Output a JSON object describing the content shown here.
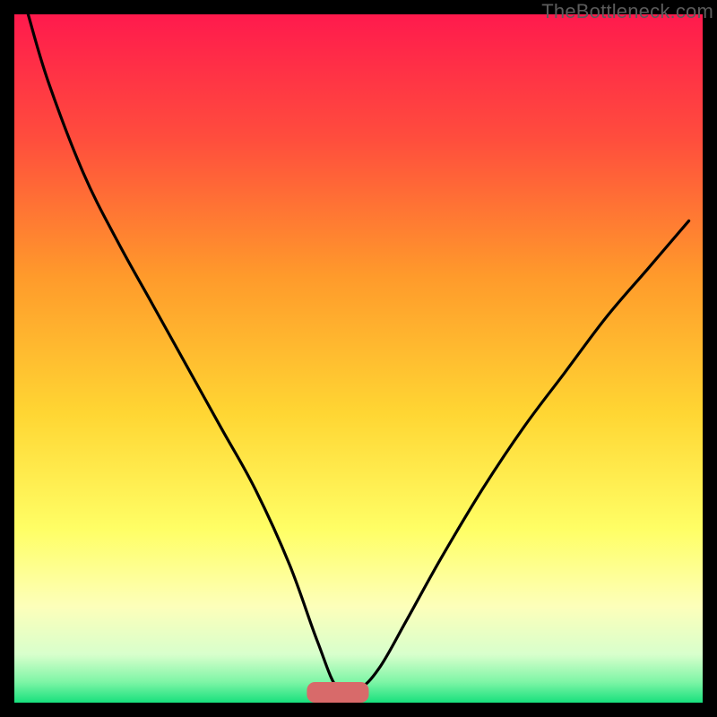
{
  "watermark": "TheBottleneck.com",
  "chart_data": {
    "type": "line",
    "title": "",
    "xlabel": "",
    "ylabel": "",
    "xlim": [
      0,
      100
    ],
    "ylim": [
      0,
      100
    ],
    "grid": false,
    "legend": false,
    "background_gradient": {
      "top_color": "#ff1a4d",
      "mid_colors": [
        "#ff7a2a",
        "#ffd633",
        "#ffff66",
        "#e8ffc7"
      ],
      "bottom_color": "#18e07d"
    },
    "marker": {
      "shape": "rounded-rect",
      "color": "#d86a6a",
      "x": 47,
      "y": 1.5,
      "width": 9,
      "height": 3
    },
    "series": [
      {
        "name": "curve",
        "x": [
          2,
          5,
          10,
          15,
          20,
          25,
          30,
          35,
          40,
          44,
          47,
          50,
          53,
          57,
          62,
          68,
          74,
          80,
          86,
          92,
          98
        ],
        "y": [
          100,
          90,
          77,
          67,
          58,
          49,
          40,
          31,
          20,
          9,
          2,
          2,
          5,
          12,
          21,
          31,
          40,
          48,
          56,
          63,
          70
        ]
      }
    ]
  }
}
